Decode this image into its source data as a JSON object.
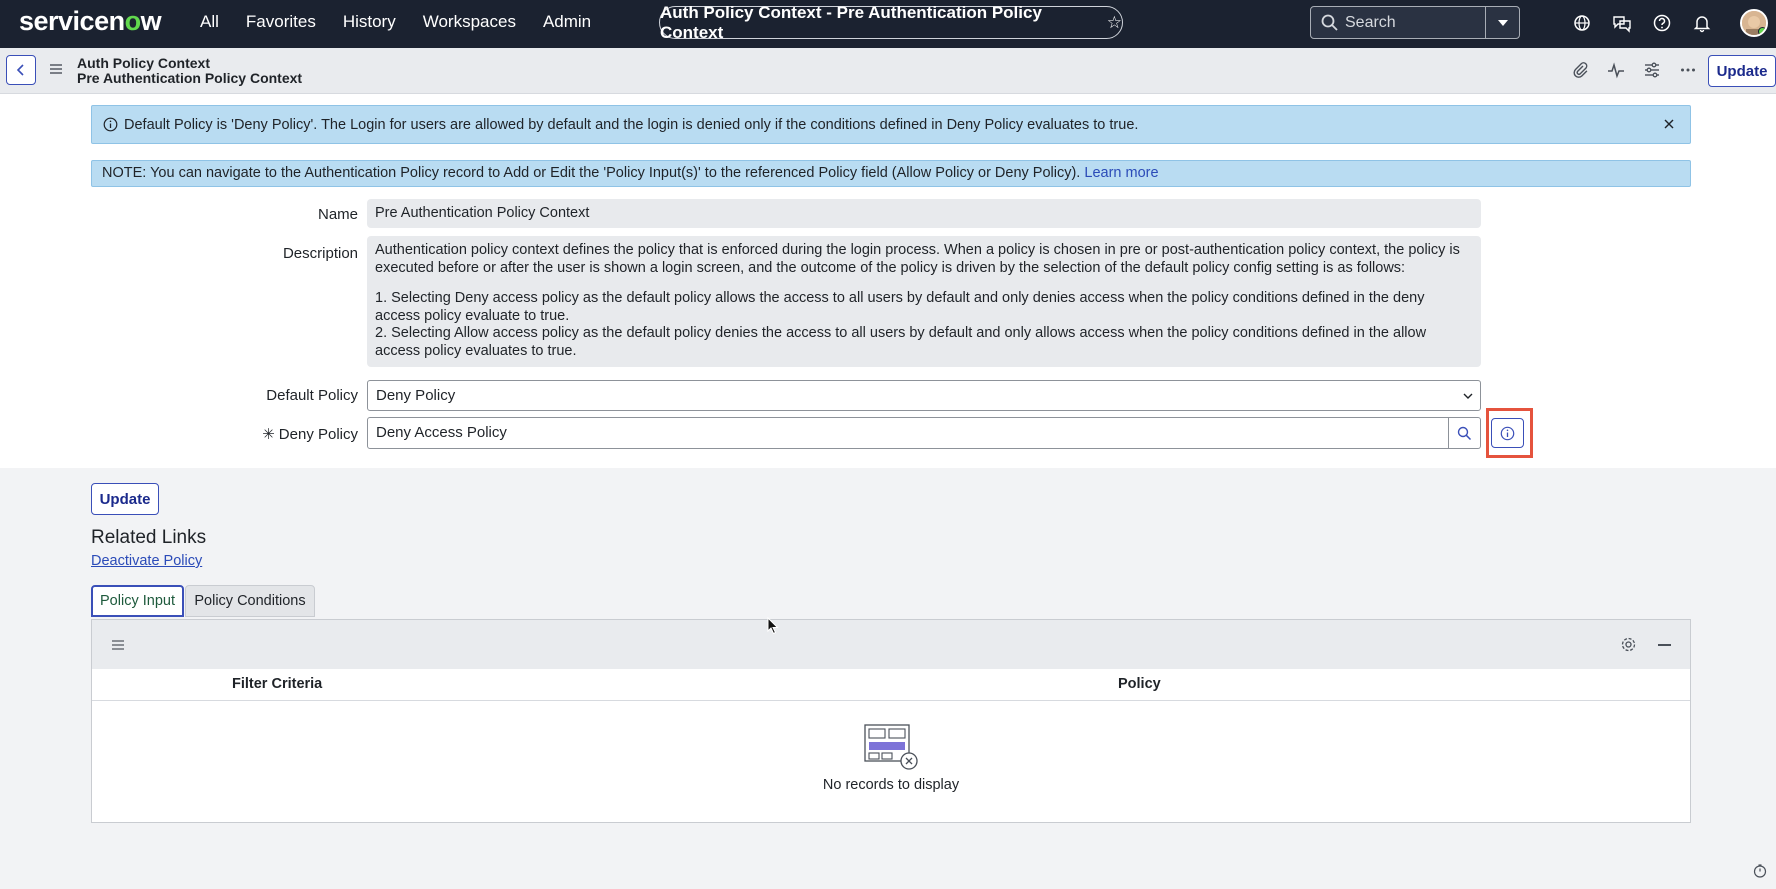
{
  "nav": {
    "logo_left": "servicen",
    "logo_o": "o",
    "logo_right": "w",
    "links": [
      "All",
      "Favorites",
      "History",
      "Workspaces",
      "Admin"
    ],
    "title": "Auth Policy Context - Pre Authentication Policy Context",
    "search_placeholder": "Search"
  },
  "header": {
    "line1": "Auth Policy Context",
    "line2": "Pre Authentication Policy Context",
    "update_label": "Update"
  },
  "info": {
    "message": "Default Policy is 'Deny Policy'. The Login for users are allowed by default and the login is denied only if the conditions defined in Deny Policy evaluates to true.",
    "note": "NOTE: You can navigate to the Authentication Policy record to Add or Edit the 'Policy Input(s)' to the referenced Policy field (Allow Policy or Deny Policy).",
    "learn_more": "Learn more"
  },
  "form": {
    "name_label": "Name",
    "name_value": "Pre Authentication Policy Context",
    "description_label": "Description",
    "description_p1": "Authentication policy context defines the policy that is enforced during the login process. When a policy is chosen in pre or post-authentication policy context, the policy is executed before or after the user is shown a login screen, and the outcome of the policy is driven by the selection of the default policy config setting is as follows:",
    "description_p2": "1. Selecting Deny access policy as the default policy allows the access to all users by default and only denies access when the policy conditions defined in the deny access policy evaluate to true.",
    "description_p3": "2. Selecting Allow access policy as the default policy denies the access to all users by default and only allows access when the policy conditions defined in the allow access policy evaluates to true.",
    "default_policy_label": "Default Policy",
    "default_policy_value": "Deny Policy",
    "deny_policy_label": "Deny Policy",
    "deny_policy_value": "Deny Access Policy"
  },
  "below": {
    "update_label": "Update",
    "related_links_title": "Related Links",
    "deactivate_link": "Deactivate Policy",
    "tabs": [
      "Policy Input",
      "Policy Conditions"
    ]
  },
  "list": {
    "columns": [
      "Filter Criteria",
      "Policy"
    ],
    "empty_text": "No records to display"
  },
  "colors": {
    "nav_bg": "#1b2230",
    "accent": "#3a4fb8",
    "info_bg": "#b9dcf2",
    "highlight": "#e5533d",
    "brand_green": "#62d84e"
  }
}
